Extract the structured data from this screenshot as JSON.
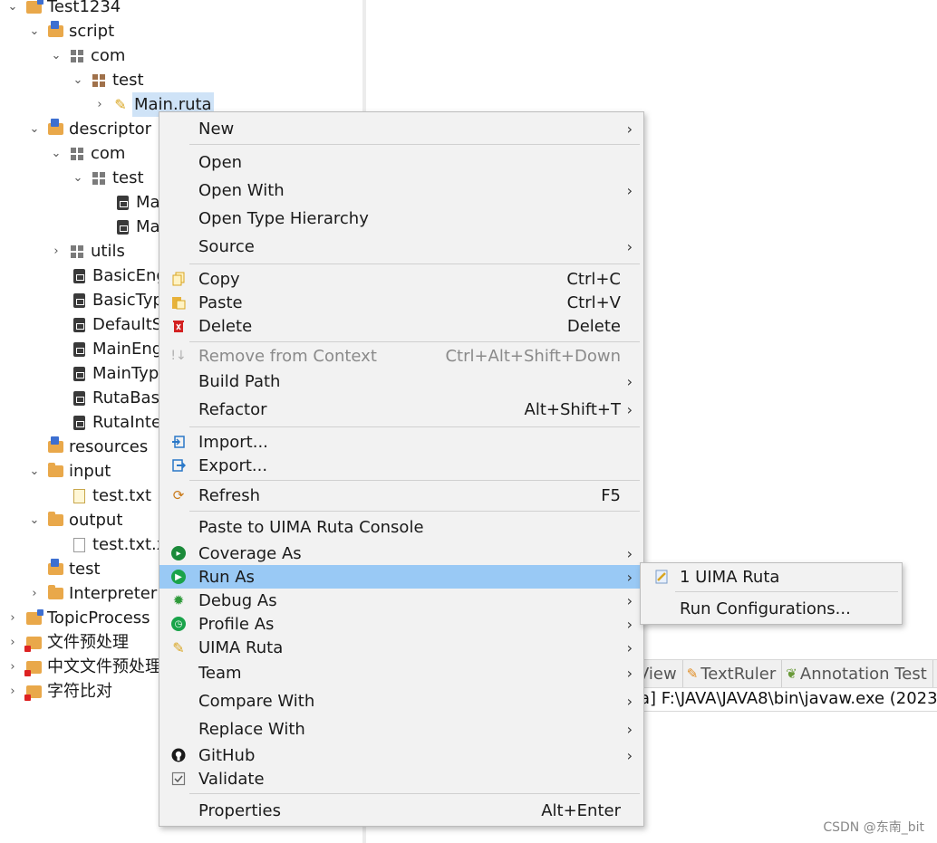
{
  "tree": {
    "rows": [
      {
        "label": "Test1234",
        "arrow": "expanded",
        "icon": "project-folder-icon"
      },
      {
        "label": "script",
        "arrow": "expanded",
        "icon": "source-folder-icon"
      },
      {
        "label": "com",
        "arrow": "expanded",
        "icon": "package-icon"
      },
      {
        "label": "test",
        "arrow": "expanded",
        "icon": "package-icon"
      },
      {
        "label": "Main.ruta",
        "arrow": "collapsed",
        "icon": "ruta-file-icon"
      },
      {
        "label": "descriptor",
        "arrow": "expanded",
        "icon": "source-folder-icon"
      },
      {
        "label": "com",
        "arrow": "expanded",
        "icon": "package-icon"
      },
      {
        "label": "test",
        "arrow": "expanded",
        "icon": "package-icon"
      },
      {
        "label": "Ma",
        "arrow": "none",
        "icon": "xml-file-icon"
      },
      {
        "label": "Ma",
        "arrow": "none",
        "icon": "xml-file-icon"
      },
      {
        "label": "utils",
        "arrow": "collapsed",
        "icon": "package-icon"
      },
      {
        "label": "BasicEng",
        "arrow": "none",
        "icon": "xml-file-icon"
      },
      {
        "label": "BasicTyp",
        "arrow": "none",
        "icon": "xml-file-icon"
      },
      {
        "label": "DefaultS",
        "arrow": "none",
        "icon": "xml-file-icon"
      },
      {
        "label": "MainEng",
        "arrow": "none",
        "icon": "xml-file-icon"
      },
      {
        "label": "MainTyp",
        "arrow": "none",
        "icon": "xml-file-icon"
      },
      {
        "label": "RutaBasi",
        "arrow": "none",
        "icon": "xml-file-icon"
      },
      {
        "label": "RutaInte",
        "arrow": "none",
        "icon": "xml-file-icon"
      },
      {
        "label": "resources",
        "arrow": "none",
        "icon": "source-folder-icon"
      },
      {
        "label": "input",
        "arrow": "expanded",
        "icon": "folder-icon"
      },
      {
        "label": "test.txt",
        "arrow": "none",
        "icon": "text-file-icon"
      },
      {
        "label": "output",
        "arrow": "expanded",
        "icon": "folder-icon"
      },
      {
        "label": "test.txt.xr",
        "arrow": "none",
        "icon": "document-file-icon"
      },
      {
        "label": "test",
        "arrow": "none",
        "icon": "source-folder-icon"
      },
      {
        "label": "Interpreter",
        "arrow": "collapsed",
        "icon": "folder-icon"
      },
      {
        "label": "TopicProcess",
        "arrow": "collapsed",
        "icon": "project-folder-icon"
      },
      {
        "label": "文件预处理",
        "arrow": "collapsed",
        "icon": "project-error-icon"
      },
      {
        "label": "中文文件预处理",
        "arrow": "collapsed",
        "icon": "project-error-icon"
      },
      {
        "label": "字符比对",
        "arrow": "collapsed",
        "icon": "project-error-icon"
      }
    ]
  },
  "context_menu": {
    "items": [
      {
        "label": "New",
        "shortcut": "",
        "submenu": true,
        "icon": "",
        "disabled": false
      },
      {
        "label": "Open",
        "shortcut": "",
        "submenu": false,
        "icon": "",
        "disabled": false
      },
      {
        "label": "Open With",
        "shortcut": "",
        "submenu": true,
        "icon": "",
        "disabled": false
      },
      {
        "label": "Open Type Hierarchy",
        "shortcut": "",
        "submenu": false,
        "icon": "",
        "disabled": false
      },
      {
        "label": "Source",
        "shortcut": "",
        "submenu": true,
        "icon": "",
        "disabled": false
      },
      {
        "label": "Copy",
        "shortcut": "Ctrl+C",
        "submenu": false,
        "icon": "copy-icon",
        "disabled": false
      },
      {
        "label": "Paste",
        "shortcut": "Ctrl+V",
        "submenu": false,
        "icon": "paste-icon",
        "disabled": false
      },
      {
        "label": "Delete",
        "shortcut": "Delete",
        "submenu": false,
        "icon": "delete-icon",
        "disabled": false
      },
      {
        "label": "Remove from Context",
        "shortcut": "Ctrl+Alt+Shift+Down",
        "submenu": false,
        "icon": "remove-context-icon",
        "disabled": true
      },
      {
        "label": "Build Path",
        "shortcut": "",
        "submenu": true,
        "icon": "",
        "disabled": false
      },
      {
        "label": "Refactor",
        "shortcut": "Alt+Shift+T",
        "submenu": true,
        "icon": "",
        "disabled": false
      },
      {
        "label": "Import...",
        "shortcut": "",
        "submenu": false,
        "icon": "import-icon",
        "disabled": false
      },
      {
        "label": "Export...",
        "shortcut": "",
        "submenu": false,
        "icon": "export-icon",
        "disabled": false
      },
      {
        "label": "Refresh",
        "shortcut": "F5",
        "submenu": false,
        "icon": "refresh-icon",
        "disabled": false
      },
      {
        "label": "Paste to UIMA Ruta Console",
        "shortcut": "",
        "submenu": false,
        "icon": "",
        "disabled": false
      },
      {
        "label": "Coverage As",
        "shortcut": "",
        "submenu": true,
        "icon": "coverage-icon",
        "disabled": false
      },
      {
        "label": "Run As",
        "shortcut": "",
        "submenu": true,
        "icon": "run-icon",
        "disabled": false,
        "active": true
      },
      {
        "label": "Debug As",
        "shortcut": "",
        "submenu": true,
        "icon": "debug-bug-icon",
        "disabled": false
      },
      {
        "label": "Profile As",
        "shortcut": "",
        "submenu": true,
        "icon": "profile-icon",
        "disabled": false
      },
      {
        "label": "UIMA Ruta",
        "shortcut": "",
        "submenu": true,
        "icon": "pencil-icon",
        "disabled": false
      },
      {
        "label": "Team",
        "shortcut": "",
        "submenu": true,
        "icon": "",
        "disabled": false
      },
      {
        "label": "Compare With",
        "shortcut": "",
        "submenu": true,
        "icon": "",
        "disabled": false
      },
      {
        "label": "Replace With",
        "shortcut": "",
        "submenu": true,
        "icon": "",
        "disabled": false
      },
      {
        "label": "GitHub",
        "shortcut": "",
        "submenu": true,
        "icon": "github-icon",
        "disabled": false
      },
      {
        "label": "Validate",
        "shortcut": "",
        "submenu": false,
        "icon": "validate-checkbox-icon",
        "disabled": false
      },
      {
        "label": "Properties",
        "shortcut": "Alt+Enter",
        "submenu": false,
        "icon": "",
        "disabled": false
      }
    ]
  },
  "submenu": {
    "items": [
      {
        "label": "1 UIMA Ruta",
        "icon": "ruta-launch-icon"
      },
      {
        "label": "Run Configurations...",
        "icon": ""
      }
    ]
  },
  "console": {
    "tabs": [
      {
        "label": "View",
        "icon": ""
      },
      {
        "label": "TextRuler",
        "icon": "pencil-icon"
      },
      {
        "label": "Annotation Test",
        "icon": "annotation-test-icon"
      }
    ],
    "line": "a] F:\\JAVA\\JAVA8\\bin\\javaw.exe  (2023"
  },
  "watermark": "CSDN @东南_bit",
  "colors": {
    "menu_bg": "#f2f2f2",
    "menu_active": "#99c9f5",
    "tree_selected": "#cfe3f7",
    "folder": "#e9a84a"
  }
}
